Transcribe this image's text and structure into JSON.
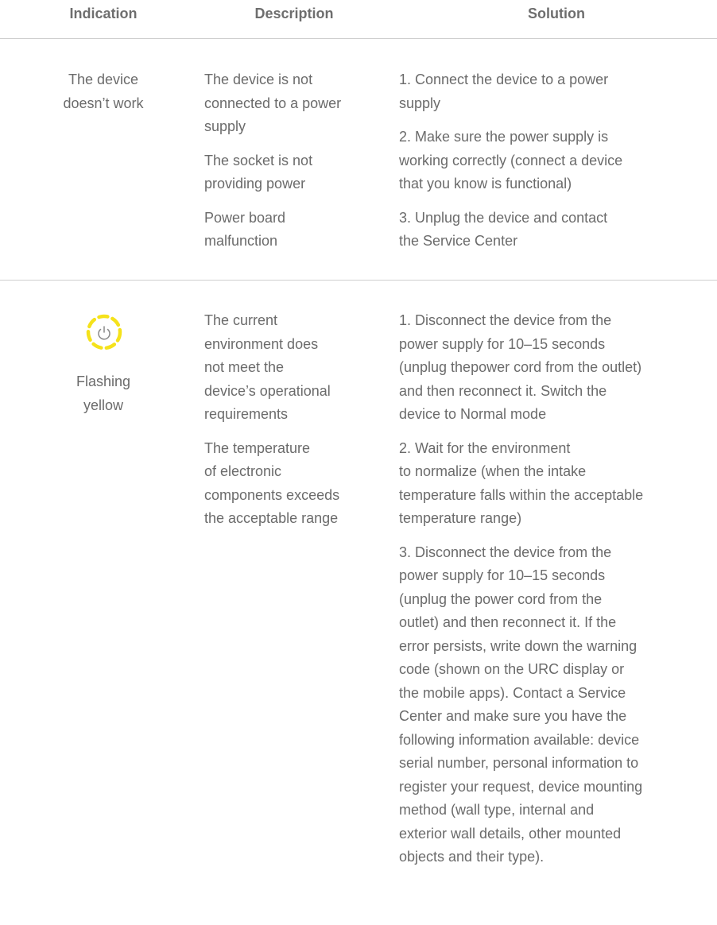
{
  "header": {
    "indication": "Indication",
    "description": "Description",
    "solution": "Solution"
  },
  "rows": [
    {
      "indication_lines": [
        "The device",
        "doesn’t work"
      ],
      "descriptions": [
        [
          "The device is not",
          "connected to a power",
          "supply"
        ],
        [
          "The socket is not",
          "providing power"
        ],
        [
          "Power board",
          "malfunction"
        ]
      ],
      "solutions": [
        [
          "1. Connect the device to a power",
          "supply"
        ],
        [
          "2. Make sure the power supply is",
          "working correctly (connect a device",
          "that you know is functional)"
        ],
        [
          "3. Unplug the device and contact",
          "the Service Center"
        ]
      ]
    },
    {
      "indicator": {
        "icon": "power-icon",
        "color": "#f5e21b"
      },
      "indication_lines": [
        "Flashing",
        "yellow"
      ],
      "descriptions": [
        [
          "The current",
          "environment does",
          "not meet the",
          "device’s operational",
          "requirements"
        ],
        [
          "The temperature",
          "of electronic",
          "components exceeds",
          "the acceptable range"
        ]
      ],
      "solutions": [
        [
          "1. Disconnect the device from the",
          "power supply for 10–15 seconds",
          "(unplug thepower cord from the outlet)",
          "and then reconnect it. Switch the",
          "device to Normal mode"
        ],
        [
          "2. Wait for the environment",
          "to normalize (when the intake",
          "temperature falls within the acceptable",
          "temperature range)"
        ],
        [
          "3. Disconnect the device from the",
          "power supply for 10–15 seconds",
          "(unplug the power cord from the",
          "outlet) and then reconnect it. If the",
          "error persists, write down the warning",
          "code (shown on the URC display or",
          "the mobile apps). Contact a Service",
          "Center and make sure you have the",
          "following information available: device",
          "serial number, personal information to",
          "register your request, device mounting",
          "method (wall type, internal and",
          "exterior wall details, other mounted",
          "objects and their type)."
        ]
      ]
    }
  ]
}
